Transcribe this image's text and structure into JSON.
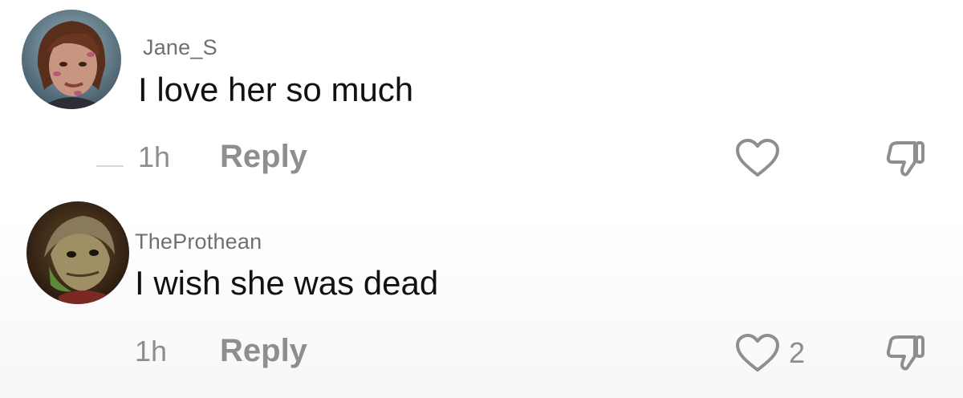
{
  "comments": [
    {
      "username": "Jane_S",
      "text": "I love her so much",
      "time": "1h",
      "reply_label": "Reply",
      "like_count": "",
      "avatar_icon": "avatar-female-character"
    },
    {
      "username": "TheProthean",
      "text": "I wish she was dead",
      "time": "1h",
      "reply_label": "Reply",
      "like_count": "2",
      "avatar_icon": "avatar-alien-character"
    }
  ],
  "colors": {
    "username": "#707070",
    "text": "#111111",
    "meta": "#8e8e8e",
    "icon_stroke": "#8e8e8e"
  }
}
